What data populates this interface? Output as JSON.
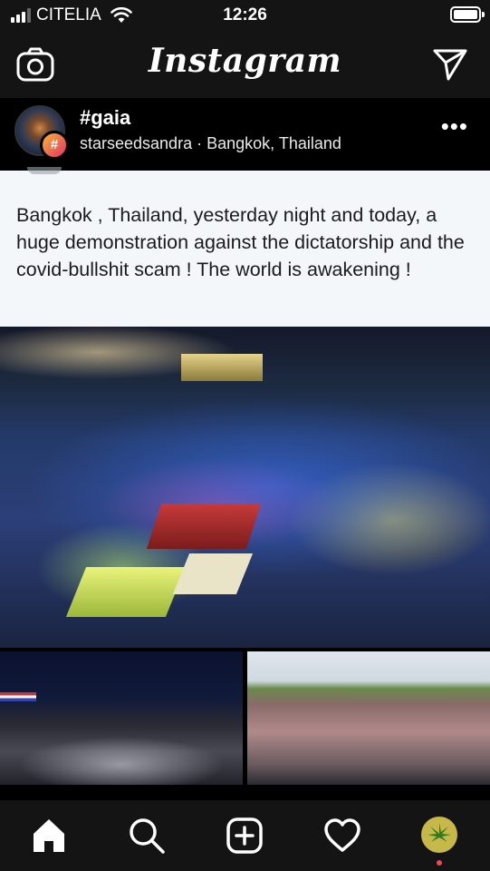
{
  "status_bar": {
    "carrier": "CITELIA",
    "time": "12:26"
  },
  "top_bar": {
    "logo": "Instagram",
    "icons": [
      "camera-icon",
      "direct-send-icon"
    ]
  },
  "post": {
    "hashtag": "#gaia",
    "username": "starseedsandra",
    "separator": "·",
    "location": "Bangkok, Thailand",
    "caption": "Bangkok , Thailand, yesterday night and today, a huge demonstration against the dictatorship and the covid-bullshit scam ! The world is awakening !",
    "more_icon": "more-options-icon"
  },
  "bottom_nav": {
    "items": [
      "home-icon",
      "search-icon",
      "add-post-icon",
      "activity-heart-icon",
      "profile-avatar"
    ],
    "accent": "#ed4956"
  }
}
